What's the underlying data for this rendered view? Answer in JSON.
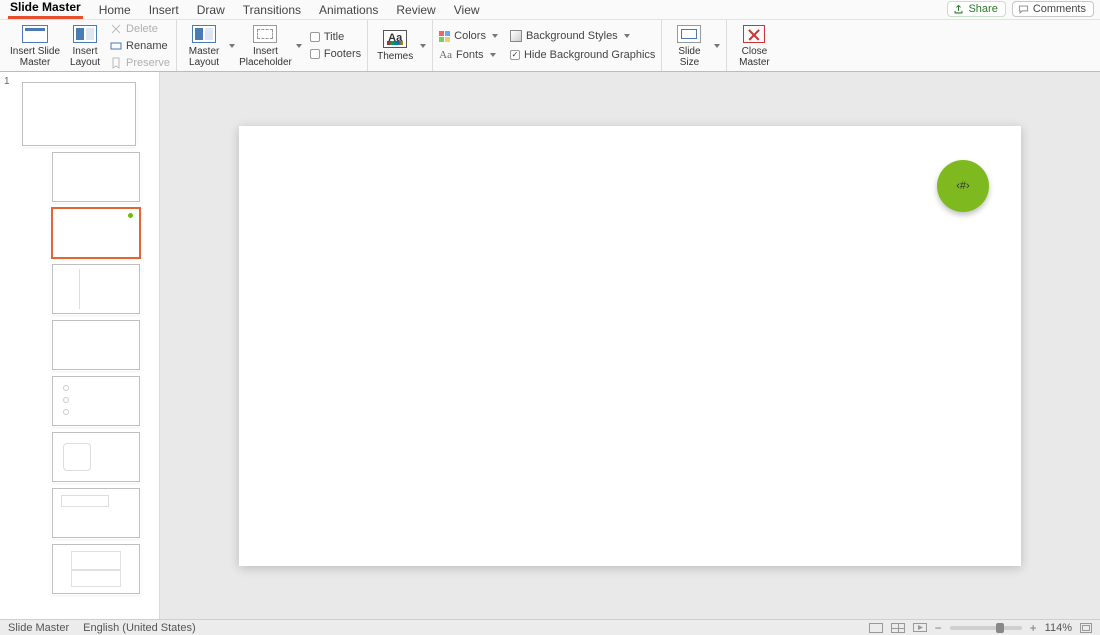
{
  "tabs": [
    "Slide Master",
    "Home",
    "Insert",
    "Draw",
    "Transitions",
    "Animations",
    "Review",
    "View"
  ],
  "activeTab": "Slide Master",
  "share": "Share",
  "comments": "Comments",
  "ribbon": {
    "insertSlideMaster": "Insert Slide\nMaster",
    "insertLayout": "Insert\nLayout",
    "delete": "Delete",
    "rename": "Rename",
    "preserve": "Preserve",
    "masterLayout": "Master\nLayout",
    "insertPlaceholder": "Insert\nPlaceholder",
    "title": "Title",
    "footers": "Footers",
    "themes": "Themes",
    "colors": "Colors",
    "fonts": "Fonts",
    "bgStyles": "Background Styles",
    "hideBg": "Hide Background Graphics",
    "slideSize": "Slide\nSize",
    "closeMaster": "Close\nMaster"
  },
  "shapeGlyph": "‹#›",
  "status": {
    "mode": "Slide Master",
    "lang": "English (United States)",
    "zoom": "114%"
  }
}
